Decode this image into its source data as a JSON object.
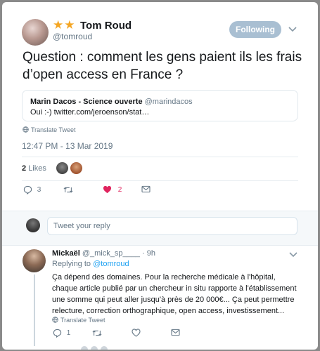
{
  "tweet": {
    "author_name": "Tom Roud",
    "author_badge": "★★",
    "author_handle": "@tomroud",
    "follow_label": "Following",
    "text": "Question : comment les gens paient ils les frais d’open access en France ?",
    "quote": {
      "author": "Marin Dacos - Science ouverte",
      "handle": "@marindacos",
      "text": "Oui :-) twitter.com/jeroenson/stat…"
    },
    "translate_label": "Translate Tweet",
    "timestamp": "12:47 PM - 13 Mar 2019",
    "likes_count": "2",
    "likes_label": "Likes",
    "actions": {
      "replies": "3",
      "retweets": "",
      "likes": "2"
    }
  },
  "reply_box": {
    "placeholder": "Tweet your reply"
  },
  "reply": {
    "author_name": "Mickaël",
    "handle": "@_mick_sp____",
    "separator": "·",
    "time": "9h",
    "replying_prefix": "Replying to",
    "replying_to": "@tomroud",
    "text": "Ça dépend des domaines. Pour la recherche médicale à l'hôpital, chaque article publié par un chercheur in situ rapporte à l'établissement une somme qui peut aller jusqu'à près de 20 000€... Ça peut permettre relecture, correction orthographique, open access, investissement...",
    "translate_label": "Translate Tweet",
    "actions": {
      "replies": "1",
      "retweets": "",
      "likes": ""
    }
  },
  "colors": {
    "accent": "#1da1f2",
    "like_active": "#e0245e",
    "follow_button": "#a9bfd2",
    "muted_text": "#657786",
    "star": "#f5a623"
  }
}
